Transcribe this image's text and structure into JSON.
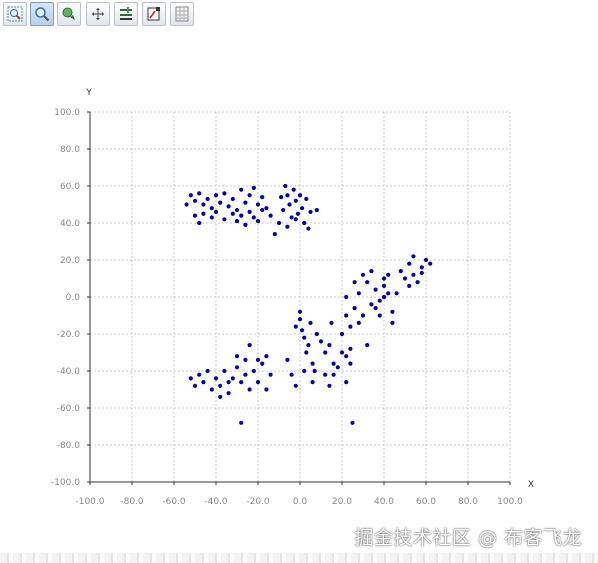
{
  "toolbar": {
    "buttons": [
      {
        "icon": "zoom-select-icon",
        "active": false
      },
      {
        "icon": "magnifier-icon",
        "active": true
      },
      {
        "icon": "zoom-out-icon",
        "active": false
      },
      {
        "icon": "pan-icon",
        "active": false
      },
      {
        "icon": "adjust-icon",
        "active": false
      },
      {
        "icon": "export-icon",
        "active": false
      },
      {
        "icon": "grid-icon",
        "active": false
      }
    ]
  },
  "watermark": "掘金技术社区 @ 布客飞龙",
  "chart_data": {
    "type": "scatter",
    "xlabel": "X",
    "ylabel": "Y",
    "xlim": [
      -100,
      100
    ],
    "ylim": [
      -100,
      100
    ],
    "xticks": [
      "-100.0",
      "-80.0",
      "-60.0",
      "-40.0",
      "-20.0",
      "0.0",
      "20.0",
      "40.0",
      "60.0",
      "80.0",
      "100.0"
    ],
    "yticks": [
      "100.0",
      "80.0",
      "60.0",
      "40.0",
      "20.0",
      "0.0",
      "-20.0",
      "-40.0",
      "-60.0",
      "-80.0",
      "-100.0"
    ],
    "grid": true,
    "point_color": "#0000aa",
    "points": [
      [
        -54,
        50
      ],
      [
        -52,
        55
      ],
      [
        -50,
        52
      ],
      [
        -48,
        56
      ],
      [
        -46,
        50
      ],
      [
        -44,
        53
      ],
      [
        -42,
        48
      ],
      [
        -40,
        55
      ],
      [
        -38,
        51
      ],
      [
        -36,
        56
      ],
      [
        -34,
        49
      ],
      [
        -32,
        53
      ],
      [
        -30,
        47
      ],
      [
        -28,
        58
      ],
      [
        -26,
        51
      ],
      [
        -24,
        55
      ],
      [
        -22,
        59
      ],
      [
        -20,
        50
      ],
      [
        -18,
        54
      ],
      [
        -16,
        48
      ],
      [
        -50,
        44
      ],
      [
        -48,
        40
      ],
      [
        -46,
        45
      ],
      [
        -42,
        43
      ],
      [
        -40,
        46
      ],
      [
        -36,
        42
      ],
      [
        -32,
        45
      ],
      [
        -30,
        41
      ],
      [
        -28,
        44
      ],
      [
        -26,
        39
      ],
      [
        -24,
        46
      ],
      [
        -22,
        43
      ],
      [
        -20,
        41
      ],
      [
        -18,
        47
      ],
      [
        -14,
        44
      ],
      [
        -12,
        34
      ],
      [
        -10,
        40
      ],
      [
        -9,
        54
      ],
      [
        -8,
        47
      ],
      [
        -7,
        60
      ],
      [
        -6,
        55
      ],
      [
        -5,
        50
      ],
      [
        -4,
        43
      ],
      [
        -3,
        58
      ],
      [
        -2,
        52
      ],
      [
        -1,
        45
      ],
      [
        0,
        55
      ],
      [
        1,
        48
      ],
      [
        2,
        40
      ],
      [
        3,
        53
      ],
      [
        5,
        46
      ],
      [
        8,
        47
      ],
      [
        -6,
        38
      ],
      [
        -2,
        42
      ],
      [
        4,
        37
      ],
      [
        -52,
        -44
      ],
      [
        -50,
        -48
      ],
      [
        -48,
        -42
      ],
      [
        -46,
        -46
      ],
      [
        -42,
        -50
      ],
      [
        -40,
        -44
      ],
      [
        -38,
        -48
      ],
      [
        -36,
        -40
      ],
      [
        -34,
        -52
      ],
      [
        -32,
        -44
      ],
      [
        -30,
        -38
      ],
      [
        -28,
        -46
      ],
      [
        -26,
        -42
      ],
      [
        -24,
        -50
      ],
      [
        -22,
        -40
      ],
      [
        -20,
        -46
      ],
      [
        -18,
        -36
      ],
      [
        -16,
        -50
      ],
      [
        -14,
        -42
      ],
      [
        -30,
        -32
      ],
      [
        -26,
        -34
      ],
      [
        -24,
        -26
      ],
      [
        -20,
        -34
      ],
      [
        -16,
        -32
      ],
      [
        -44,
        -40
      ],
      [
        -38,
        -54
      ],
      [
        -34,
        -46
      ],
      [
        -28,
        -68
      ],
      [
        -6,
        -34
      ],
      [
        -4,
        -42
      ],
      [
        -2,
        -16
      ],
      [
        0,
        -12
      ],
      [
        1,
        -18
      ],
      [
        2,
        -22
      ],
      [
        3,
        -30
      ],
      [
        4,
        -26
      ],
      [
        5,
        -14
      ],
      [
        6,
        -36
      ],
      [
        7,
        -40
      ],
      [
        8,
        -20
      ],
      [
        10,
        -24
      ],
      [
        12,
        -30
      ],
      [
        14,
        -26
      ],
      [
        15,
        -14
      ],
      [
        16,
        -36
      ],
      [
        18,
        -38
      ],
      [
        20,
        -30
      ],
      [
        22,
        -32
      ],
      [
        0,
        -8
      ],
      [
        -2,
        -48
      ],
      [
        2,
        -40
      ],
      [
        6,
        -46
      ],
      [
        12,
        -42
      ],
      [
        14,
        -48
      ],
      [
        16,
        -42
      ],
      [
        22,
        -46
      ],
      [
        24,
        -36
      ],
      [
        25,
        -68
      ],
      [
        20,
        -20
      ],
      [
        22,
        -10
      ],
      [
        24,
        -16
      ],
      [
        26,
        -6
      ],
      [
        28,
        2
      ],
      [
        30,
        -10
      ],
      [
        32,
        8
      ],
      [
        34,
        -4
      ],
      [
        36,
        4
      ],
      [
        38,
        -2
      ],
      [
        40,
        6
      ],
      [
        42,
        12
      ],
      [
        44,
        -8
      ],
      [
        46,
        2
      ],
      [
        48,
        14
      ],
      [
        50,
        10
      ],
      [
        52,
        18
      ],
      [
        54,
        22
      ],
      [
        56,
        8
      ],
      [
        58,
        16
      ],
      [
        60,
        20
      ],
      [
        62,
        18
      ],
      [
        26,
        8
      ],
      [
        30,
        12
      ],
      [
        34,
        14
      ],
      [
        38,
        -10
      ],
      [
        40,
        0
      ],
      [
        42,
        2
      ],
      [
        44,
        -14
      ],
      [
        28,
        -14
      ],
      [
        32,
        -26
      ],
      [
        36,
        -6
      ],
      [
        40,
        10
      ],
      [
        52,
        6
      ],
      [
        54,
        12
      ],
      [
        58,
        13
      ],
      [
        22,
        0
      ],
      [
        24,
        -28
      ]
    ]
  }
}
